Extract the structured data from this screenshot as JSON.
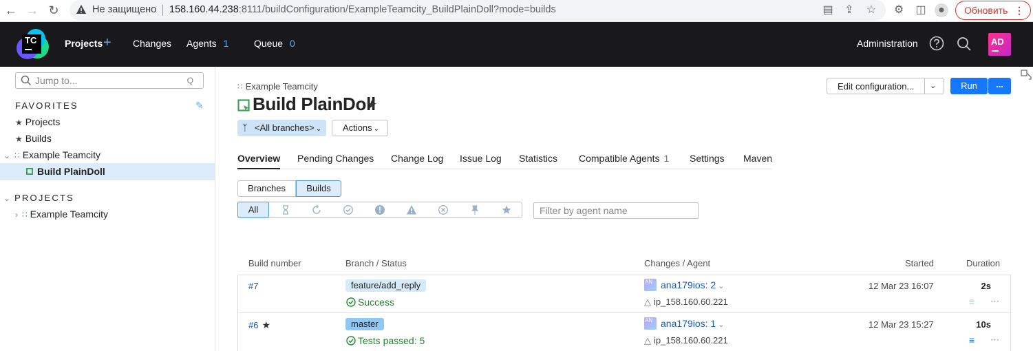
{
  "browser": {
    "insecure_label": "Не защищено",
    "url_host": "158.160.44.238",
    "url_rest": ":8111/buildConfiguration/ExampleTeamcity_BuildPlainDoll?mode=builds",
    "update_label": "Обновить"
  },
  "header": {
    "logo_text": "TC",
    "projects": "Projects",
    "changes": "Changes",
    "agents": "Agents",
    "agents_count": "1",
    "queue": "Queue",
    "queue_count": "0",
    "administration": "Administration",
    "avatar_initials": "AD"
  },
  "sidebar": {
    "jump_placeholder": "Jump to...",
    "jump_shortcut": "Q",
    "favorites_title": "FAVORITES",
    "fav_projects": "Projects",
    "fav_builds": "Builds",
    "fav_project": "Example Teamcity",
    "fav_build": "Build PlainDoll",
    "projects_title": "PROJECTS",
    "project_item": "Example Teamcity"
  },
  "main": {
    "breadcrumb": "Example Teamcity",
    "title": "Build PlainDoll",
    "branch_selector": "<All branches>",
    "actions": "Actions",
    "edit_config": "Edit configuration...",
    "run": "Run",
    "more": "...",
    "tabs": [
      {
        "label": "Overview"
      },
      {
        "label": "Pending Changes"
      },
      {
        "label": "Change Log"
      },
      {
        "label": "Issue Log"
      },
      {
        "label": "Statistics"
      },
      {
        "label": "Compatible Agents",
        "count": "1"
      },
      {
        "label": "Settings"
      },
      {
        "label": "Maven"
      }
    ],
    "seg_branches": "Branches",
    "seg_builds": "Builds",
    "filter_all": "All",
    "agent_filter_placeholder": "Filter by agent name",
    "columns": {
      "build_number": "Build number",
      "branch_status": "Branch / Status",
      "changes_agent": "Changes / Agent",
      "started": "Started",
      "duration": "Duration"
    },
    "builds": [
      {
        "number": "#7",
        "branch": "feature/add_reply",
        "status": "Success",
        "changes": "ana179ios: 2",
        "agent": "ip_158.160.60.221",
        "started": "12 Mar 23 16:07",
        "duration": "2s"
      },
      {
        "number": "#6",
        "branch": "master",
        "status": "Tests passed: 5",
        "changes": "ana179ios: 1",
        "agent": "ip_158.160.60.221",
        "started": "12 Mar 23 15:27",
        "duration": "10s"
      }
    ]
  },
  "colors": {
    "accent": "#1677ff",
    "success": "#1c8c2a",
    "header_bg": "#19191c",
    "link": "#1a5ab8"
  }
}
